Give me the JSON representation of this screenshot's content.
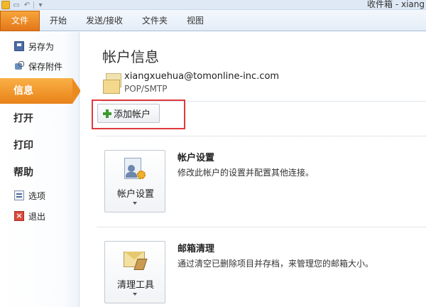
{
  "window": {
    "title": "收件箱 - xiang"
  },
  "ribbon": {
    "file_tab": "文件",
    "tabs": [
      "开始",
      "发送/接收",
      "文件夹",
      "视图"
    ]
  },
  "nav": {
    "save_as": "另存为",
    "save_attachments": "保存附件",
    "info": "信息",
    "open": "打开",
    "print": "打印",
    "help": "帮助",
    "options": "选项",
    "exit": "退出"
  },
  "main": {
    "title": "帐户信息",
    "account": {
      "email": "xiangxuehua@tomonline-inc.com",
      "type": "POP/SMTP"
    },
    "add_account_label": "添加帐户",
    "account_settings": {
      "button_label": "帐户设置",
      "title": "帐户设置",
      "description": "修改此帐户的设置并配置其他连接。"
    },
    "cleanup": {
      "button_label": "清理工具",
      "title": "邮箱清理",
      "description": "通过清空已删除项目并存档，来管理您的邮箱大小。"
    }
  },
  "colors": {
    "file_tab": "#e3761a",
    "selected_nav": "#e98218",
    "highlight": "#e0393c"
  }
}
